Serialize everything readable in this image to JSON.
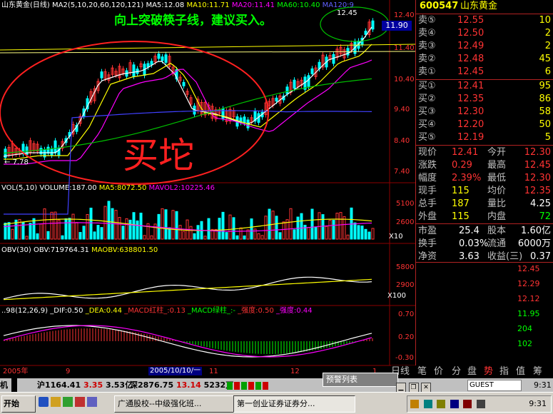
{
  "chart_header": {
    "name": "山东黄金",
    "period": "(日线)",
    "ma_label": "MA2(5,10,20,60,120,121)",
    "ma5": "MA5:12.08",
    "ma10": "MA10:11.71",
    "ma20": "MA20:11.41",
    "ma60": "MA60:10.40",
    "ma120": "MA120:9",
    "marker_high": "12.45",
    "price_tag": "11.90",
    "low_label": "7.78",
    "headline": "向上突破筷子线，建议买入。",
    "big_label": "买坨"
  },
  "price_axis": [
    "12.40",
    "11.40",
    "10.40",
    "9.40",
    "8.40",
    "7.40"
  ],
  "vol_header": {
    "title": "VOL(5,10)",
    "volume": "VOLUME:187.00",
    "ma5": "MA5:8072.50",
    "ma10": "MAVOL2:10225.46"
  },
  "vol_axis": [
    "5100",
    "2600",
    "X10"
  ],
  "obv_header": {
    "title": "OBV(30)",
    "obv": "OBV:719764.31",
    "maobv": "MAOBV:638801.50"
  },
  "obv_axis": [
    "5800",
    "2900",
    "X100"
  ],
  "macd_header": {
    "title": "..98(12,26,9)",
    "dif": "_DIF:0.50",
    "dea": "_DEA:0.44",
    "red": "_MACD红柱_:0.13",
    "green": "_MACD绿柱_:-",
    "qd1": "_强度:0.50",
    "qd2": "_强度:0.44"
  },
  "macd_axis": [
    "0.70",
    "0.20",
    "-0.30"
  ],
  "time_axis": {
    "y2005": "2005年",
    "m9": "9",
    "cursor": "2005/10/10/一",
    "m11": "11",
    "m12": "12",
    "m1": "1"
  },
  "panel": {
    "code": "600547",
    "name": "山东黄金",
    "sell": [
      {
        "label": "卖⑤",
        "price": "12.55",
        "vol": "10"
      },
      {
        "label": "卖④",
        "price": "12.50",
        "vol": "2"
      },
      {
        "label": "卖③",
        "price": "12.49",
        "vol": "2"
      },
      {
        "label": "卖②",
        "price": "12.48",
        "vol": "45"
      },
      {
        "label": "卖①",
        "price": "12.45",
        "vol": "6"
      }
    ],
    "buy": [
      {
        "label": "买①",
        "price": "12.41",
        "vol": "95"
      },
      {
        "label": "买②",
        "price": "12.35",
        "vol": "86"
      },
      {
        "label": "买③",
        "price": "12.30",
        "vol": "58"
      },
      {
        "label": "买④",
        "price": "12.20",
        "vol": "50"
      },
      {
        "label": "买⑤",
        "price": "12.19",
        "vol": "5"
      }
    ],
    "stats": [
      {
        "l1": "现价",
        "v1": "12.41",
        "l2": "今开",
        "v2": "12.30"
      },
      {
        "l1": "涨跌",
        "v1": "0.29",
        "l2": "最高",
        "v2": "12.45"
      },
      {
        "l1": "幅度",
        "v1": "2.39%",
        "l2": "最低",
        "v2": "12.30"
      },
      {
        "l1": "现手",
        "v1": "115",
        "l2": "均价",
        "v2": "12.35"
      },
      {
        "l1": "总手",
        "v1": "187",
        "l2": "量比",
        "v2": "4.25"
      },
      {
        "l1": "外盘",
        "v1": "115",
        "l2": "内盘",
        "v2": "72"
      }
    ],
    "fin": [
      {
        "l1": "市盈",
        "v1": "25.4",
        "l2": "股本",
        "v2": "1.60亿"
      },
      {
        "l1": "换手",
        "v1": "0.03%",
        "l2": "流通",
        "v2": "6000万"
      },
      {
        "l1": "净资",
        "v1": "3.63",
        "l2": "收益(三)",
        "v2": "0.37"
      }
    ],
    "ticks": [
      "12.45",
      "12.29",
      "12.12",
      "11.95",
      "204",
      "102"
    ]
  },
  "tabs": [
    "日线",
    "笔",
    "价",
    "分",
    "盘",
    "势",
    "指",
    "值",
    "筹"
  ],
  "quote_bar": {
    "label": "机",
    "sh": "沪1164.41",
    "sh_chg": "3.35",
    "sh_amt": "3.53亿",
    "sz": "深2876.75",
    "sz_chg": "13.14",
    "sz_amt": "5232万",
    "alert": "预警列表",
    "user": "GUEST",
    "clock": "9:31"
  },
  "taskbar": {
    "start": "开始",
    "win1": "广通股校--中级强化班...",
    "win2": "第一创业证券证券分...",
    "time": "9:31"
  },
  "colors": {
    "bg": "#000000",
    "up": "#ff3333",
    "down": "#00ffff",
    "ma5": "#ffffff",
    "ma10": "#ffff00",
    "ma20": "#ff00ff",
    "ma60": "#00c000",
    "ma120": "#4040ff",
    "grid": "#8b0000"
  }
}
